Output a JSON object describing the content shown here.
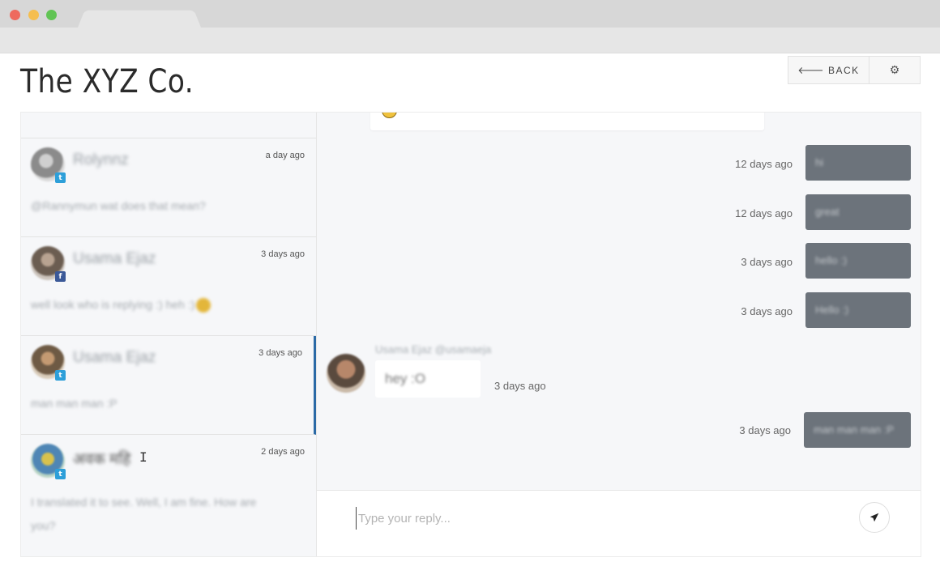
{
  "brand": {
    "name": "The XYZ Co."
  },
  "header": {
    "back_label": "BACK",
    "back_icon": "arrow-left-icon",
    "settings_icon": "gear-icon"
  },
  "conversations": [
    {
      "name": "Rolynnz",
      "time": "a day ago",
      "preview": "@Rannymun wat does that mean?",
      "network": "twitter",
      "avatar_color": "#9a9a9a",
      "active": false
    },
    {
      "name": "Usama Ejaz",
      "time": "3 days ago",
      "preview": "well look who is replying :) heh :)",
      "network": "facebook",
      "avatar_color": "#8a7a6c",
      "active": false
    },
    {
      "name": "Usama Ejaz",
      "time": "3 days ago",
      "preview": "man man man :P",
      "network": "twitter",
      "avatar_color": "#a38466",
      "active": true
    },
    {
      "name": "अवक महि",
      "time": "2 days ago",
      "preview": "I translated it to see. Well, I am fine. How are you?",
      "network": "twitter",
      "avatar_color": "#6fa3c6",
      "active": false
    }
  ],
  "messages": [
    {
      "direction": "out",
      "text": "hi",
      "time": "12 days ago"
    },
    {
      "direction": "out",
      "text": "great",
      "time": "12 days ago"
    },
    {
      "direction": "out",
      "text": "hello :)",
      "time": "3 days ago"
    },
    {
      "direction": "out",
      "text": "Hello :)",
      "time": "3 days ago"
    },
    {
      "direction": "in",
      "sender": "Usama Ejaz @usamaeja",
      "text": "hey :O",
      "time": "3 days ago"
    },
    {
      "direction": "out",
      "text": "man man man :P",
      "time": "3 days ago"
    }
  ],
  "reply": {
    "placeholder": "Type your reply...",
    "send_icon": "paper-plane-icon"
  },
  "colors": {
    "accent": "#2b6aa6",
    "outgoing_bubble": "#6c737b",
    "twitter": "#2d9fd9",
    "facebook": "#3b5998"
  }
}
